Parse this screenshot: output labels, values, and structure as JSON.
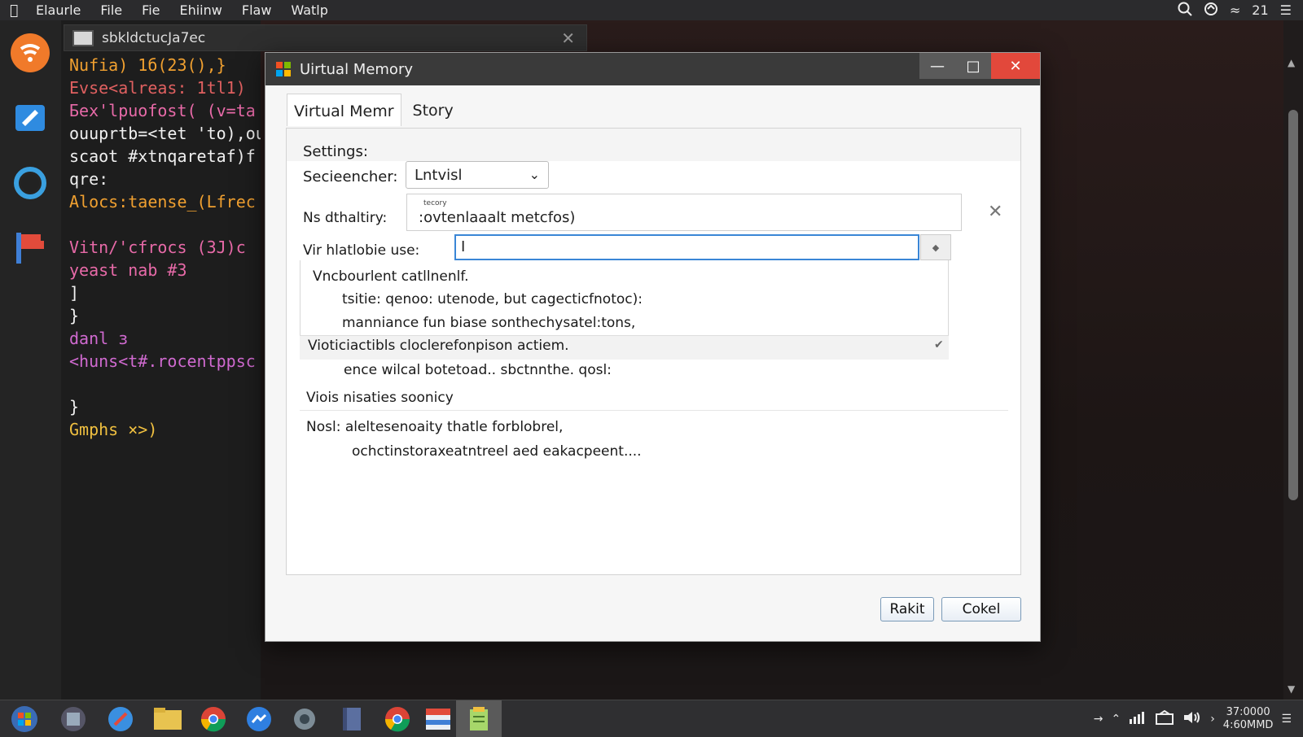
{
  "menubar": {
    "items": [
      "Elaurle",
      "File",
      "Fie",
      "Ehiinw",
      "Flaw",
      "Watlp"
    ],
    "right_text": "21"
  },
  "editor": {
    "tab_title": "sbkldctucJa7ec",
    "code_lines": [
      {
        "text": "Nufia) 1б(23(),}",
        "color": "#f0a030"
      },
      {
        "text": "Evse<alreas: 1tl1)",
        "color": "#e06060"
      },
      {
        "text": "Бex'lpuofost( (v=ta",
        "color": "#e86aa8"
      },
      {
        "text": "ouuprtb=<tet 'to),our",
        "color": "#f0f0f0"
      },
      {
        "text": "scaot #xtnqaretaf)f",
        "color": "#f0f0f0"
      },
      {
        "text": "qre:",
        "color": "#f0f0f0"
      },
      {
        "text": "Alocs:taense_(Lfrec",
        "color": "#f0a030"
      },
      {
        "text": "",
        "color": "#f0f0f0"
      },
      {
        "text": "Vitn/'cfrocs  (ЗЈ)c",
        "color": "#e86aa8"
      },
      {
        "text": "yeast nab #3",
        "color": "#e86aa8"
      },
      {
        "text": "]",
        "color": "#f0f0f0"
      },
      {
        "text": "}",
        "color": "#f0f0f0"
      },
      {
        "text": "danl з",
        "color": "#d06ad0"
      },
      {
        "text": "<huns<t#.rocentppsc",
        "color": "#d06ad0"
      },
      {
        "text": "",
        "color": "#f0f0f0"
      },
      {
        "text": "}",
        "color": "#f0f0f0"
      },
      {
        "text": "Gmphs ×>)",
        "color": "#f0c040"
      }
    ]
  },
  "dialog": {
    "title": "Uirtual Memory",
    "tabs": [
      "Virtual Memr",
      "Story"
    ],
    "settings_label": "Settings:",
    "select_label": "Secieencher:",
    "select_value": "Lntvisl",
    "field_a_label": "Ns dthaltiry:",
    "field_a_tiny": "tecory",
    "field_a_value": ":ovtenlaaalt metcfos)",
    "field_b_label": "Vir hlatlobie use:",
    "field_b_value": "I",
    "list_lines": [
      "Vncbourlent catllnenlf.",
      "tsitie: qenoo: utenode, but cagecticfnotoc):",
      "manniance fun biase sonthechysatel:tons,",
      "Vioticiactibls cloclerefonpison actiem.",
      "ence wilcal botetoad.. sbctnnthe. qosl:"
    ],
    "section_title": "Viois nisaties soonicy",
    "note_lines": [
      "Nosl: aleltesenoaity thatle forblobrel,",
      "ochctinstoraxeatntreel aed eakacpeent...."
    ],
    "apply_label": "Rakit",
    "cancel_label": "Cokel"
  },
  "tray": {
    "time": "37:0000",
    "date": "4:60MMD"
  },
  "colors": {
    "accent": "#3a86d6",
    "close": "#e2483b"
  }
}
